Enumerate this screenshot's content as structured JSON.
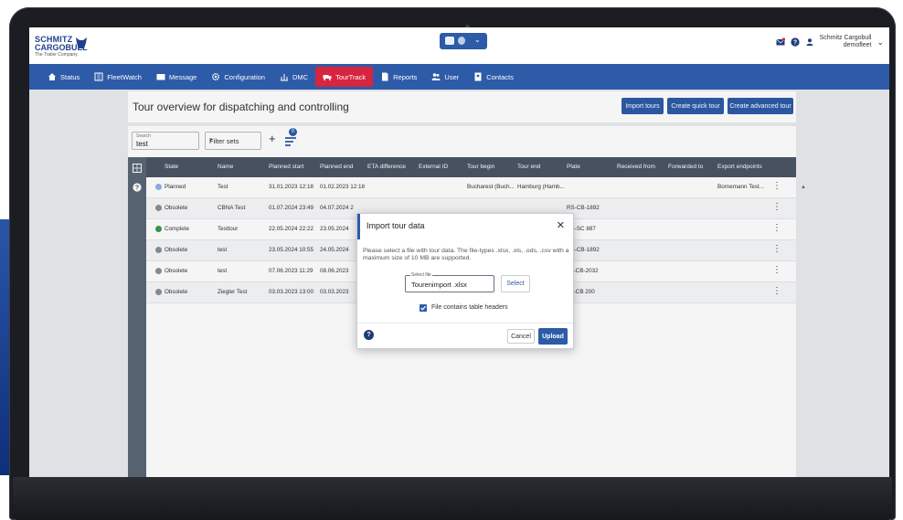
{
  "brand": {
    "line1": "SCHMITZ",
    "line2": "CARGOBULL",
    "tagline": "The Trailer Company."
  },
  "header": {
    "user_line1": "Schmitz Cargobull",
    "user_line2": "demofleet"
  },
  "nav": {
    "items": [
      {
        "label": "Status",
        "icon": "home-icon"
      },
      {
        "label": "FleetWatch",
        "icon": "map-icon"
      },
      {
        "label": "Message",
        "icon": "message-icon"
      },
      {
        "label": "Configuration",
        "icon": "gear-icon"
      },
      {
        "label": "DMC",
        "icon": "dmc-icon"
      },
      {
        "label": "TourTrack",
        "icon": "truck-icon",
        "active": true
      },
      {
        "label": "Reports",
        "icon": "report-icon"
      },
      {
        "label": "User",
        "icon": "users-icon"
      },
      {
        "label": "Contacts",
        "icon": "contacts-icon"
      }
    ]
  },
  "page": {
    "title": "Tour overview for dispatching and controlling",
    "buttons": {
      "import": "Import tours",
      "quick": "Create quick tour",
      "advanced": "Create advanced tour"
    }
  },
  "toolbar": {
    "search_label": "Search",
    "search_value": "test",
    "filter_label": "Filter sets",
    "plus": "+",
    "badge": "0"
  },
  "table": {
    "headers": [
      "State",
      "Name",
      "Planned start",
      "Planned end",
      "ETA difference",
      "External ID",
      "Tour begin",
      "Tour end",
      "Plate",
      "Received from",
      "Forwarded to",
      "Export endpoints"
    ],
    "rows": [
      {
        "state": "Planned",
        "name": "Test",
        "start": "31.01.2023 12:18",
        "end": "01.02.2023 12:18",
        "begin": "Bucharest (Buch...",
        "tend": "Hamburg (Hamb...",
        "plate": "",
        "export": "Bornemann Test..."
      },
      {
        "state": "Obsolete",
        "name": "CBNA Test",
        "start": "01.07.2024 23:49",
        "end": "04.07.2024 2",
        "begin": "",
        "tend": "",
        "plate": "RS-CB-1892",
        "export": ""
      },
      {
        "state": "Complete",
        "name": "Testtour",
        "start": "22.05.2024 22:22",
        "end": "23.05.2024",
        "begin": "",
        "tend": "",
        "plate": "RS-SC 887",
        "export": ""
      },
      {
        "state": "Obsolete",
        "name": "test",
        "start": "23.05.2024 10:55",
        "end": "24.05.2024",
        "begin": "",
        "tend": "",
        "plate": "RS-CB-1892",
        "export": ""
      },
      {
        "state": "Obsolete",
        "name": "test",
        "start": "07.06.2023 11:29",
        "end": "08.06.2023",
        "begin": "",
        "tend": "",
        "plate": "ST-CB-2032",
        "export": ""
      },
      {
        "state": "Obsolete",
        "name": "Ziegler Test",
        "start": "03.03.2023 13:00",
        "end": "03.03.2023",
        "begin": "",
        "tend": "",
        "plate": "ST-CB 200",
        "export": ""
      }
    ]
  },
  "modal": {
    "title": "Import tour data",
    "close": "✕",
    "description": "Please select a file with tour data. The file-types .xlsx, .xls, .ods, .csv with a maximum size of 10 MB are supported.",
    "file_label": "Select file",
    "file_value": "Tourenimport .xlsx",
    "select_label": "Select",
    "checkbox_label": "File contains table headers",
    "checkbox_checked": true,
    "cancel_label": "Cancel",
    "upload_label": "Upload"
  },
  "colors": {
    "primary": "#2d5ba8",
    "active_tab": "#d7243f",
    "state_planned": "#8fb4e6",
    "state_obsolete": "#8a8f96",
    "state_complete": "#3e9a4a"
  }
}
